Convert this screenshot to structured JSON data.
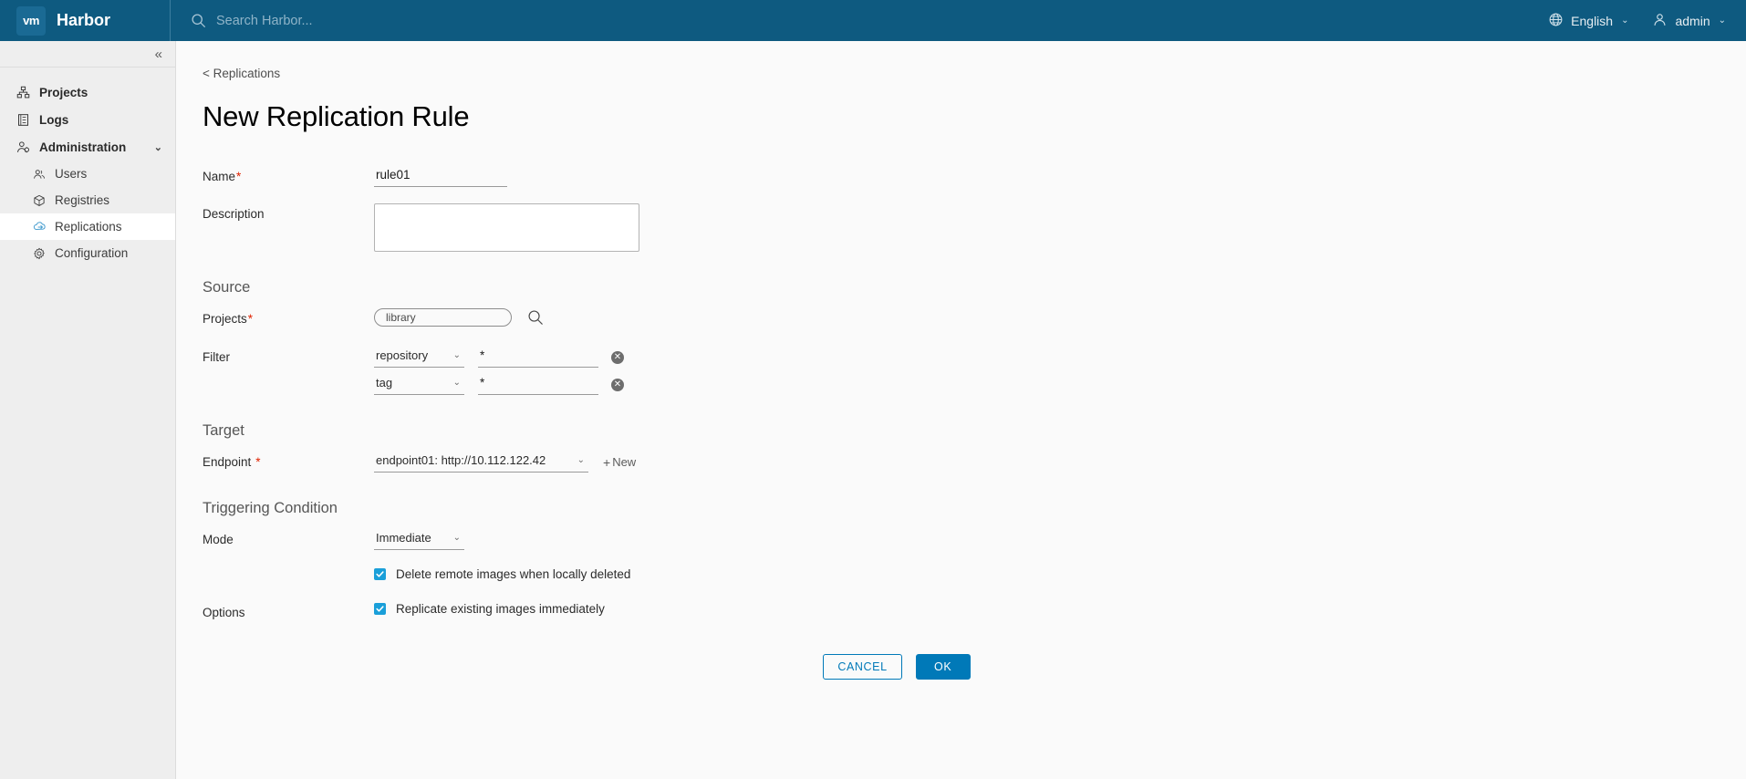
{
  "header": {
    "logo_text": "vm",
    "logo_icon": "vmware-logo-icon",
    "brand": "Harbor",
    "search_icon": "search-icon",
    "search_placeholder": "Search Harbor...",
    "language": "English",
    "language_icon": "globe-icon",
    "user": "admin",
    "user_icon": "user-avatar-icon",
    "caret": "⌄",
    "bg_color": "#0e5a80"
  },
  "sidebar": {
    "collapse_icon": "double-chevron-left-icon",
    "collapse_glyph": "«",
    "items": [
      {
        "label": "Projects",
        "icon": "projects-icon"
      },
      {
        "label": "Logs",
        "icon": "logs-icon"
      },
      {
        "label": "Administration",
        "icon": "administration-icon",
        "expand_glyph": "⌄"
      }
    ],
    "sub_items": [
      {
        "label": "Users",
        "icon": "users-icon",
        "active": false
      },
      {
        "label": "Registries",
        "icon": "registries-icon",
        "active": false
      },
      {
        "label": "Replications",
        "icon": "replications-icon",
        "active": true
      },
      {
        "label": "Configuration",
        "icon": "configuration-gear-icon",
        "active": false
      }
    ]
  },
  "main": {
    "breadcrumb": "< Replications",
    "title": "New Replication Rule",
    "name": {
      "label": "Name",
      "required_mark": "*",
      "value": "rule01"
    },
    "description": {
      "label": "Description",
      "value": "",
      "placeholder": ""
    },
    "source": {
      "section_title": "Source",
      "projects": {
        "label": "Projects",
        "required_mark": "*",
        "chip_value": "library",
        "search_icon": "search-icon"
      },
      "filter": {
        "label": "Filter",
        "rows": [
          {
            "type": "repository",
            "value": "*",
            "remove_icon": "remove-circle-icon",
            "remove_glyph": "✕"
          },
          {
            "type": "tag",
            "value": "*",
            "remove_icon": "remove-circle-icon",
            "remove_glyph": "✕"
          }
        ],
        "caret": "⌄"
      }
    },
    "target": {
      "section_title": "Target",
      "endpoint": {
        "label": "Endpoint",
        "required_mark": "*",
        "value": "endpoint01: http://10.112.122.42",
        "caret": "⌄",
        "new_label": "New",
        "new_plus": "+",
        "new_icon": "plus-icon"
      }
    },
    "triggering": {
      "section_title": "Triggering Condition",
      "mode": {
        "label": "Mode",
        "value": "Immediate",
        "caret": "⌄"
      },
      "delete_remote": {
        "label": "Delete remote images when locally deleted",
        "checked": true
      }
    },
    "options": {
      "label": "Options",
      "replicate_existing": {
        "label": "Replicate existing images immediately",
        "checked": true
      }
    },
    "buttons": {
      "cancel": "CANCEL",
      "ok": "OK"
    }
  },
  "colors": {
    "header_blue": "#0e5a80",
    "accent_blue": "#0079b8",
    "checkbox_blue": "#1a9fd9",
    "required_red": "#e02200"
  }
}
